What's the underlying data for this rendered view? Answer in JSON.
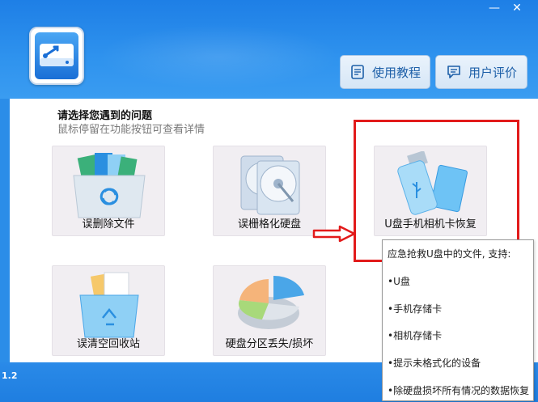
{
  "window": {
    "minimize_label": "—",
    "close_label": "✕"
  },
  "header": {
    "tutorial_label": "使用教程",
    "review_label": "用户评价"
  },
  "main": {
    "title": "请选择您遇到的问题",
    "subtitle": "鼠标停留在功能按钮可查看详情",
    "tiles": [
      {
        "label": "误删除文件"
      },
      {
        "label": "误栅格化硬盘"
      },
      {
        "label": "U盘手机相机卡恢复"
      },
      {
        "label": "误清空回收站"
      },
      {
        "label": "硬盘分区丢失/损坏"
      }
    ]
  },
  "tooltip": {
    "heading": "应急抢救U盘中的文件, 支持:",
    "items": [
      "•U盘",
      "•手机存储卡",
      "•相机存储卡",
      "•提示未格式化的设备",
      "•除硬盘损坏所有情况的数据恢复"
    ]
  },
  "footer": {
    "version": "1.2"
  },
  "colors": {
    "accent": "#2b8de8",
    "highlight": "#e21b1b",
    "button_text": "#1d5fa8"
  }
}
